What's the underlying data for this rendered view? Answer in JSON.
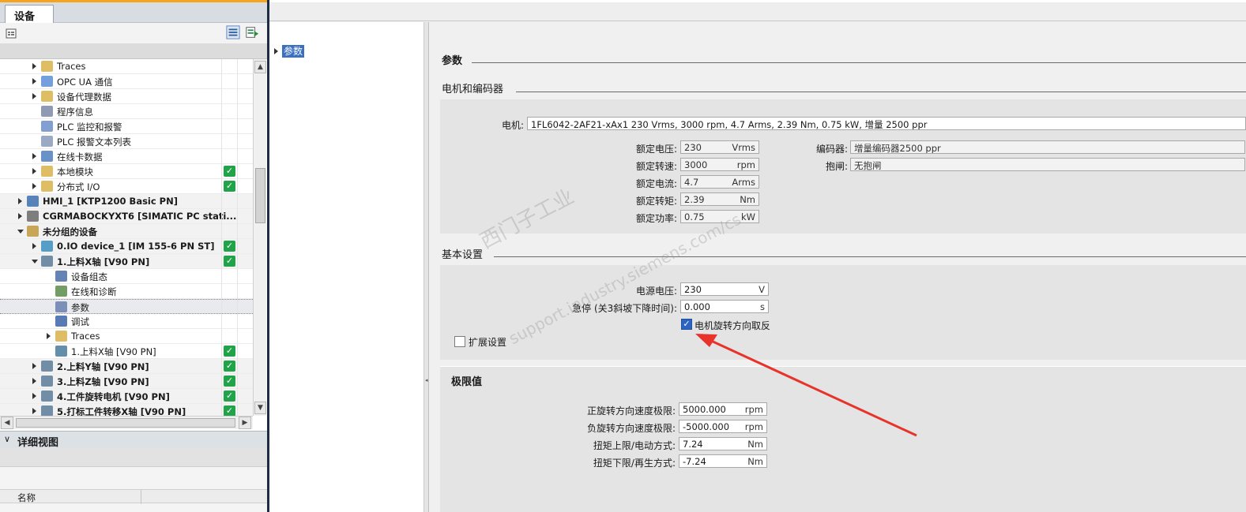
{
  "left_panel": {
    "tab": "设备",
    "tree": [
      {
        "label": "Traces",
        "level": 2,
        "expand": "right",
        "icon": "folder-icon",
        "status": false
      },
      {
        "label": "OPC UA 通信",
        "level": 2,
        "expand": "right",
        "icon": "opc-ua-icon",
        "status": false
      },
      {
        "label": "设备代理数据",
        "level": 2,
        "expand": "right",
        "icon": "folder-icon",
        "status": false
      },
      {
        "label": "程序信息",
        "level": 2,
        "expand": "none",
        "icon": "program-info-icon",
        "status": false
      },
      {
        "label": "PLC 监控和报警",
        "level": 2,
        "expand": "none",
        "icon": "plc-alarm-icon",
        "status": false
      },
      {
        "label": "PLC 报警文本列表",
        "level": 2,
        "expand": "none",
        "icon": "text-list-icon",
        "status": false
      },
      {
        "label": "在线卡数据",
        "level": 2,
        "expand": "right",
        "icon": "memory-card-icon",
        "status": false
      },
      {
        "label": "本地模块",
        "level": 2,
        "expand": "right",
        "icon": "folder-icon",
        "status": true
      },
      {
        "label": "分布式 I/O",
        "level": 2,
        "expand": "right",
        "icon": "folder-icon",
        "status": true
      },
      {
        "label": "HMI_1 [KTP1200 Basic PN]",
        "level": 1,
        "expand": "right",
        "icon": "hmi-icon",
        "status": false,
        "bold": true
      },
      {
        "label": "CGRMABOCKYXT6 [SIMATIC PC stati...",
        "level": 1,
        "expand": "right",
        "icon": "pc-station-icon",
        "status": false,
        "bold": true
      },
      {
        "label": "未分组的设备",
        "level": 1,
        "expand": "down",
        "icon": "ungrouped-devices-icon",
        "status": false,
        "bold": true
      },
      {
        "label": "0.IO device_1 [IM 155-6 PN ST]",
        "level": 2,
        "expand": "right",
        "icon": "io-device-icon",
        "status": true,
        "bold": true
      },
      {
        "label": "1.上料X轴 [V90 PN]",
        "level": 2,
        "expand": "down",
        "icon": "drive-icon",
        "status": true,
        "bold": true
      },
      {
        "label": "设备组态",
        "level": 3,
        "expand": "none",
        "icon": "device-config-icon",
        "status": false
      },
      {
        "label": "在线和诊断",
        "level": 3,
        "expand": "none",
        "icon": "diagnostics-icon",
        "status": false
      },
      {
        "label": "参数",
        "level": 3,
        "expand": "none",
        "icon": "parameters-icon",
        "status": false,
        "selected": true
      },
      {
        "label": "调试",
        "level": 3,
        "expand": "none",
        "icon": "commissioning-icon",
        "status": false
      },
      {
        "label": "Traces",
        "level": 3,
        "expand": "right",
        "icon": "folder-icon",
        "status": false
      },
      {
        "label": "1.上料X轴 [V90 PN]",
        "level": 3,
        "expand": "none",
        "icon": "axis-icon",
        "status": true
      },
      {
        "label": "2.上料Y轴 [V90 PN]",
        "level": 2,
        "expand": "right",
        "icon": "drive-icon",
        "status": true,
        "bold": true
      },
      {
        "label": "3.上料Z轴 [V90 PN]",
        "level": 2,
        "expand": "right",
        "icon": "drive-icon",
        "status": true,
        "bold": true
      },
      {
        "label": "4.工件旋转电机 [V90 PN]",
        "level": 2,
        "expand": "right",
        "icon": "drive-icon",
        "status": true,
        "bold": true
      },
      {
        "label": "5.打标工件转移X轴 [V90 PN]",
        "level": 2,
        "expand": "right",
        "icon": "drive-icon",
        "status": true,
        "bold": true
      }
    ],
    "detail_view": {
      "title": "详细视图",
      "column_name": "名称"
    }
  },
  "nav": {
    "item": "参数"
  },
  "content": {
    "section_params": "参数",
    "section_motor": "电机和编码器",
    "motor_label": "电机:",
    "motor_value": "1FL6042-2AF21-xAx1   230 Vrms, 3000 rpm, 4.7 Arms, 2.39 Nm, 0.75 kW, 增量 2500 ppr",
    "ratings": [
      {
        "label": "额定电压:",
        "value": "230",
        "unit": "Vrms"
      },
      {
        "label": "额定转速:",
        "value": "3000",
        "unit": "rpm"
      },
      {
        "label": "额定电流:",
        "value": "4.7",
        "unit": "Arms"
      },
      {
        "label": "额定转矩:",
        "value": "2.39",
        "unit": "Nm"
      },
      {
        "label": "额定功率:",
        "value": "0.75",
        "unit": "kW"
      }
    ],
    "encoder_label": "编码器:",
    "encoder_value": "增量编码器2500 ppr",
    "brake_label": "抱闸:",
    "brake_value": "无抱闸",
    "section_basic": "基本设置",
    "supply_label": "电源电压:",
    "supply_value": "230",
    "supply_unit": "V",
    "estop_label": "急停 (关3斜坡下降时间):",
    "estop_value": "0.000",
    "estop_unit": "s",
    "invert_label": "电机旋转方向取反",
    "invert_checked": true,
    "extended_label": "扩展设置",
    "extended_checked": false,
    "section_limits": "极限值",
    "limits": [
      {
        "label": "正旋转方向速度极限:",
        "value": "5000.000",
        "unit": "rpm"
      },
      {
        "label": "负旋转方向速度极限:",
        "value": "-5000.000",
        "unit": "rpm"
      },
      {
        "label": "扭矩上限/电动方式:",
        "value": "7.24",
        "unit": "Nm"
      },
      {
        "label": "扭矩下限/再生方式:",
        "value": "-7.24",
        "unit": "Nm"
      }
    ],
    "watermark_line1": "西门子工业",
    "watermark_line2": "support.industry.siemens.com/cs",
    "annotation_color": "#e8332b"
  }
}
